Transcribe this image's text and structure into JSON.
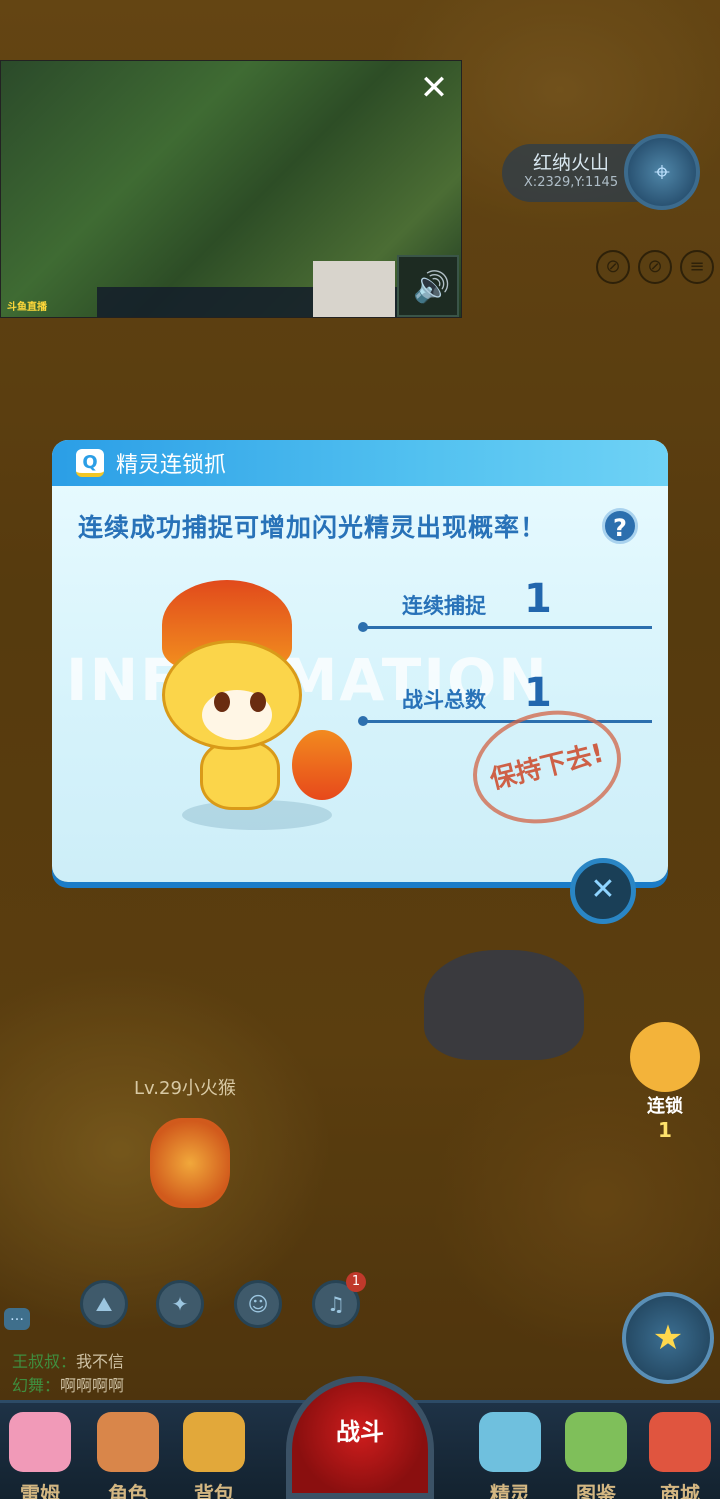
{
  "video": {
    "close_icon": "close-icon",
    "volume_icon": "volume-icon",
    "logo": "斗鱼直播"
  },
  "location": {
    "name": "红纳火山",
    "coords": "X:2329,Y:1145"
  },
  "modal": {
    "title": "精灵连锁抓",
    "subtitle": "连续成功捕捉可增加闪光精灵出现概率！",
    "help": "?",
    "watermark": "INFORMATION",
    "stats": [
      {
        "label": "连续捕捉",
        "value": "1"
      },
      {
        "label": "战斗总数",
        "value": "1"
      }
    ],
    "stamp": "保持下去!"
  },
  "scene": {
    "player_label": "Lv.29小火猴",
    "combo_label": "连锁",
    "combo_count": "1",
    "notification_count": "1"
  },
  "chat": [
    {
      "who": "王叔叔：",
      "msg": "我不信"
    },
    {
      "who": "幻舞：",
      "msg": "啊啊啊啊"
    }
  ],
  "nav": {
    "items": [
      "雷姆",
      "角色",
      "背包",
      "精灵",
      "图鉴",
      "商城"
    ],
    "battle": "战斗"
  },
  "colors": {
    "accent": "#2b9ee6",
    "stat_blue": "#2872b8",
    "stamp": "#cd5032"
  }
}
